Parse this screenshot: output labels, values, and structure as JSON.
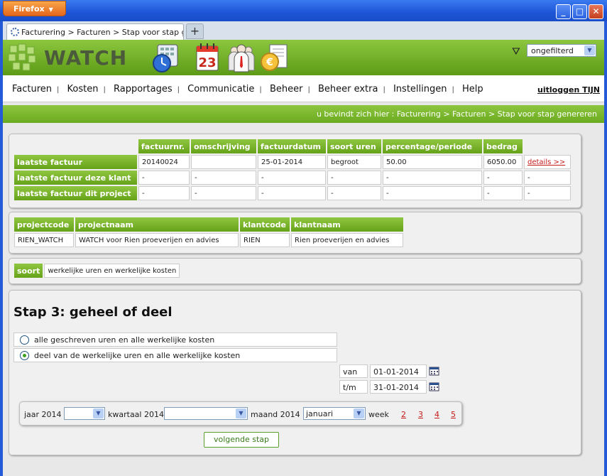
{
  "browser": {
    "app_button": "Firefox",
    "tab_title": "Facturering > Facturen > Stap voor stap ge...",
    "new_tab": "+"
  },
  "header": {
    "logo": "WATCH",
    "filter_value": "ongefilterd",
    "day_number": "23"
  },
  "menu": {
    "items": [
      "Facturen",
      "Kosten",
      "Rapportages",
      "Communicatie",
      "Beheer",
      "Beheer extra",
      "Instellingen",
      "Help"
    ],
    "logout": "uitloggen TIJN"
  },
  "breadcrumb": "u bevindt zich hier : Facturering > Facturen > Stap voor stap genereren",
  "invoices": {
    "headers": [
      "factuurnr.",
      "omschrijving",
      "factuurdatum",
      "soort uren",
      "percentage/periode",
      "bedrag"
    ],
    "rows": [
      {
        "label": "laatste factuur",
        "cells": [
          "20140024",
          "",
          "25-01-2014",
          "begroot",
          "50.00",
          "6050.00"
        ],
        "link": "details >>"
      },
      {
        "label": "laatste factuur deze klant",
        "cells": [
          "-",
          "-",
          "-",
          "-",
          "-",
          "-"
        ],
        "link": "-"
      },
      {
        "label": "laatste factuur dit project",
        "cells": [
          "-",
          "-",
          "-",
          "-",
          "-",
          "-"
        ],
        "link": "-"
      }
    ]
  },
  "project": {
    "headers": [
      "projectcode",
      "projectnaam",
      "klantcode",
      "klantnaam"
    ],
    "values": [
      "RIEN_WATCH",
      "WATCH voor Rien proeverijen en advies",
      "RIEN",
      "Rien proeverijen en advies"
    ]
  },
  "soort": {
    "label": "soort",
    "value": "werkelijke uren en werkelijke kosten"
  },
  "step": {
    "title": "Stap 3: geheel of deel",
    "options": [
      {
        "label": "alle geschreven uren en alle werkelijke kosten",
        "selected": false
      },
      {
        "label": "deel van de werkelijke uren en alle werkelijke kosten",
        "selected": true
      }
    ],
    "van_label": "van",
    "van_value": "01-01-2014",
    "tm_label": "t/m",
    "tm_value": "31-01-2014",
    "jaar_label": "jaar 2014",
    "kwartaal_label": "kwartaal 2014",
    "maand_label": "maand 2014",
    "maand_value": "januari",
    "week_label": "week",
    "weeks": [
      "2",
      "3",
      "4",
      "5"
    ],
    "next_button": "volgende stap"
  }
}
